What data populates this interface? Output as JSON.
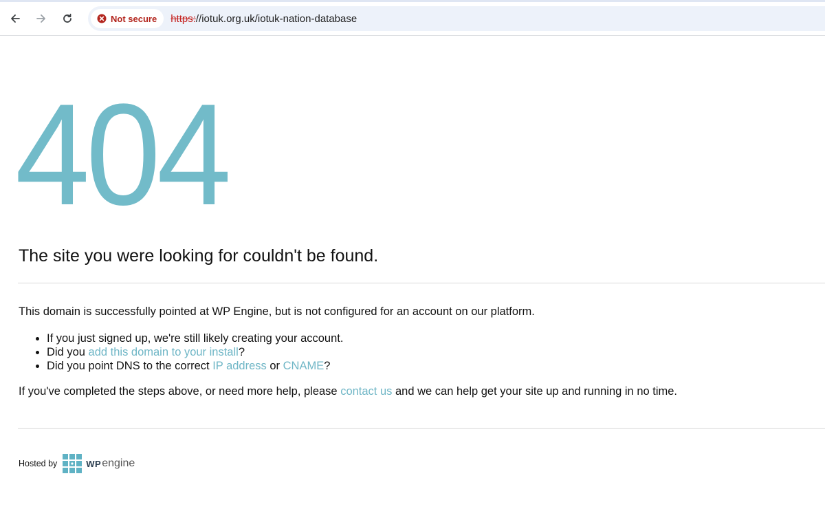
{
  "browser": {
    "security_label": "Not secure",
    "url_scheme": "https:",
    "url_rest": "//iotuk.org.uk/iotuk-nation-database"
  },
  "page": {
    "error_code": "404",
    "headline": "The site you were looking for couldn't be found.",
    "intro": "This domain is successfully pointed at WP Engine, but is not configured for an account on our platform.",
    "bullets": {
      "b1": "If you just signed up, we're still likely creating your account.",
      "b2_pre": "Did you ",
      "b2_link": "add this domain to your install",
      "b2_post": "?",
      "b3_pre": "Did you point DNS to the correct ",
      "b3_link1": "IP address",
      "b3_mid": " or ",
      "b3_link2": "CNAME",
      "b3_post": "?"
    },
    "help_pre": "If you've completed the steps above, or need more help, please ",
    "help_link": "contact us",
    "help_post": " and we can help get your site up and running in no time."
  },
  "footer": {
    "hosted_by": "Hosted by",
    "logo_wp": "WP",
    "logo_engine": "engine"
  },
  "colors": {
    "accent": "#72bbc9",
    "link": "#6fb6c6",
    "warning": "#b3261e"
  }
}
